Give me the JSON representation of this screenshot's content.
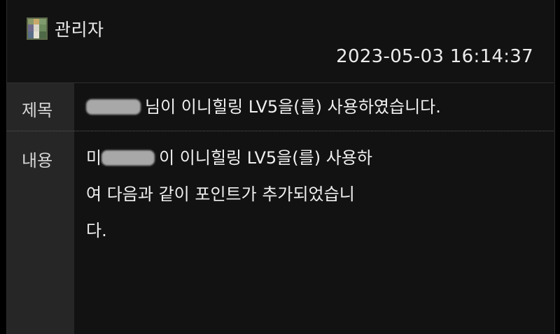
{
  "sender": {
    "name": "관리자",
    "icon": "avatar-icon"
  },
  "timestamp": "2023-05-03 16:14:37",
  "fields": {
    "subject_label": "제목",
    "content_label": "내용"
  },
  "subject": {
    "redacted_prefix": "",
    "text": "님이 이니힐링 LV5을(를) 사용하였습니다."
  },
  "content": {
    "line1_prefix": "미",
    "line1_text": "이 이니힐링 LV5을(를) 사용하",
    "line2": "여 다음과 같이 포인트가 추가되었습니",
    "line3": "다."
  },
  "colors": {
    "background": "#000000",
    "panel": "#121212",
    "label_column": "#262626",
    "text": "#f0f0f0"
  }
}
